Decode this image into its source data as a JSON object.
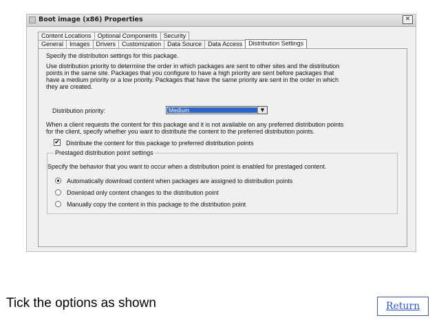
{
  "window": {
    "title": "Boot image (x86) Properties",
    "close_glyph": "✕"
  },
  "tabs": {
    "back_row": [
      "Content Locations",
      "Optional Components",
      "Security"
    ],
    "front_row": [
      "General",
      "Images",
      "Drivers",
      "Customization",
      "Data Source",
      "Data Access",
      "Distribution Settings"
    ],
    "active": "Distribution Settings"
  },
  "panel": {
    "intro": "Specify the distribution settings for this package.",
    "priority_desc": [
      "Use distribution priority to determine the order in which packages are sent to other sites and the distribution",
      "points in the same site. Packages that you configure to have a high priority are sent before packages that",
      "have a medium priority or a low priority. Packages that have the same priority are sent in the order in which",
      "they are created."
    ],
    "priority_label": "Distribution priority:",
    "priority_value": "Medium",
    "client_desc": [
      "When a client requests the content for this package and it is not available on any preferred distribution points",
      "for the client, specify whether you want to distribute the content to the preferred distribution points."
    ],
    "distribute_checkbox": {
      "label": "Distribute the content for this package to preferred distribution points",
      "checked": true,
      "glyph": "✔"
    },
    "prestaged": {
      "legend": "Prestaged distribution point settings",
      "desc": "Specify the behavior that you want to occur when a distribution point is enabled for prestaged content.",
      "options": [
        {
          "label": "Automatically download content when packages are assigned to distribution points",
          "selected": true
        },
        {
          "label": "Download only content changes to the distribution point",
          "selected": false
        },
        {
          "label": "Manually copy the content in this package to the distribution point",
          "selected": false
        }
      ]
    }
  },
  "slide": {
    "caption": "Tick the options as shown",
    "return_label": "Return"
  }
}
